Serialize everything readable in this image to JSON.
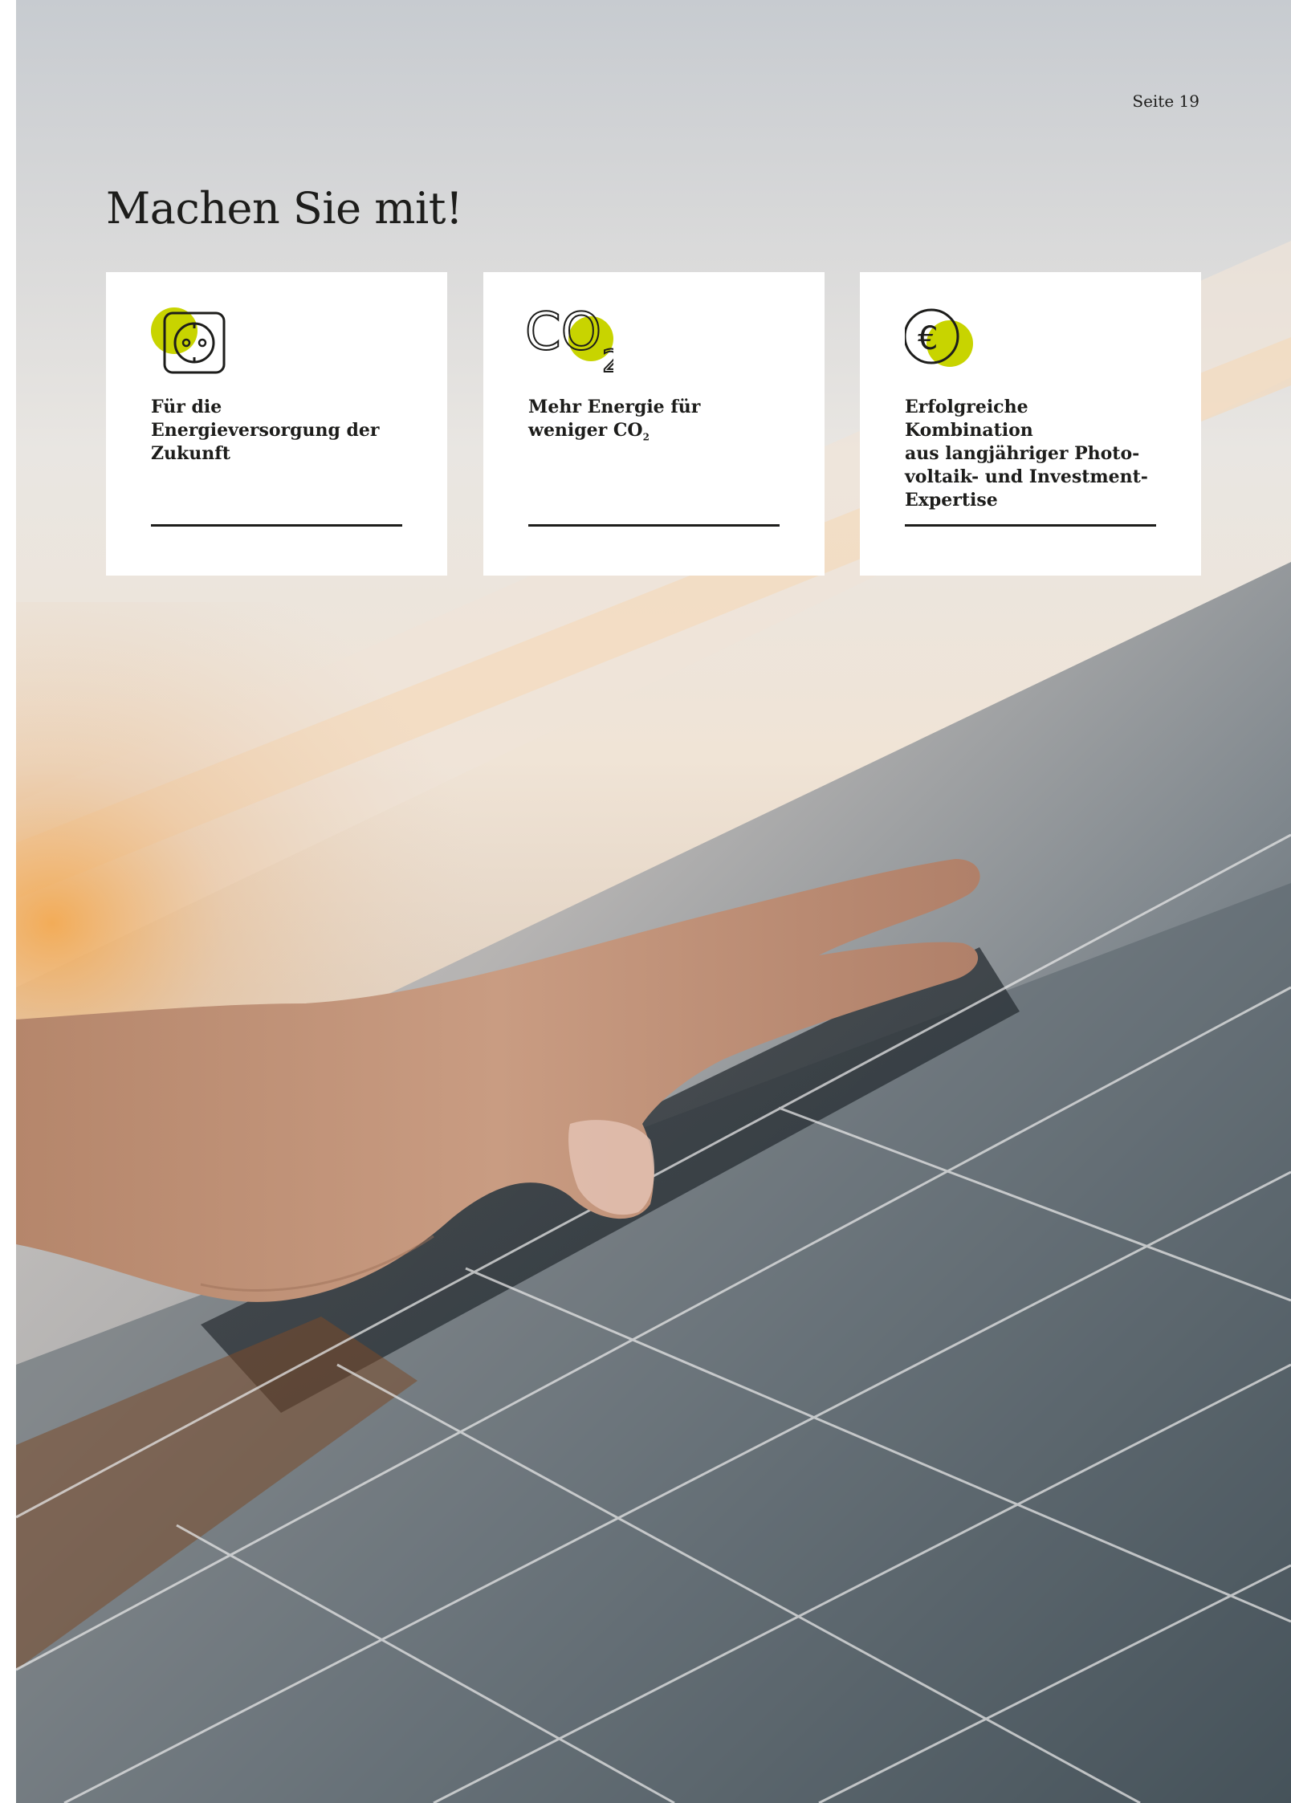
{
  "page": {
    "number_label": "Seite 19"
  },
  "title": "Machen Sie mit!",
  "cards": [
    {
      "icon": "power-socket-icon",
      "text": "Für die Energieversorgung der Zukunft"
    },
    {
      "icon": "co2-icon",
      "icon_text": "CO",
      "icon_subscript": "2",
      "text_main": "Mehr Energie für weniger CO",
      "text_subscript": "2"
    },
    {
      "icon": "euro-coin-icon",
      "icon_text": "€",
      "text_lines": [
        "Erfolgreiche Kombination",
        "aus langjähriger Photo-",
        "voltaik- und Investment-",
        "Expertise"
      ]
    }
  ],
  "colors": {
    "accent": "#c8d400",
    "text": "#1d1d1b",
    "card_background": "#ffffff"
  },
  "background_image": "hand-on-solar-panel-photo"
}
